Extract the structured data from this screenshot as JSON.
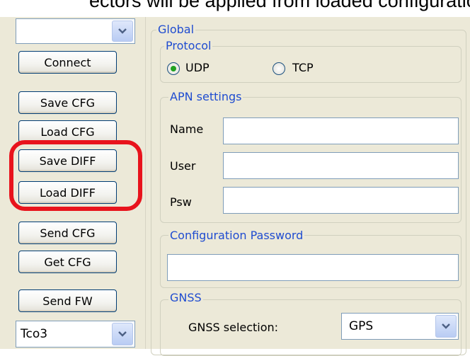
{
  "banner": {
    "text": "ectors will be applied from loaded configuration"
  },
  "left": {
    "top_combo": {
      "value": ""
    },
    "buttons": {
      "connect": "Connect",
      "save_cfg": "Save CFG",
      "load_cfg": "Load CFG",
      "save_diff": "Save DIFF",
      "load_diff": "Load DIFF",
      "send_cfg": "Send CFG",
      "get_cfg": "Get CFG",
      "send_fw": "Send FW"
    },
    "device_combo": {
      "value": "Tco3"
    }
  },
  "global": {
    "legend": "Global",
    "protocol": {
      "legend": "Protocol",
      "options": [
        "UDP",
        "TCP"
      ],
      "selected": "UDP"
    },
    "apn": {
      "legend": "APN settings",
      "name_label": "Name",
      "user_label": "User",
      "psw_label": "Psw",
      "name_value": "",
      "user_value": "",
      "psw_value": ""
    },
    "config_password": {
      "legend": "Configuration Password",
      "value": ""
    },
    "gnss": {
      "legend": "GNSS",
      "selection_label": "GNSS selection:",
      "selection_value": "GPS"
    }
  },
  "colors": {
    "panel_bg": "#ece9d8",
    "legend_text": "#1f4cd0",
    "highlight": "#e8131c",
    "radio_dot": "#21a121"
  },
  "icons": {
    "dropdown": "chevron-down-icon"
  }
}
